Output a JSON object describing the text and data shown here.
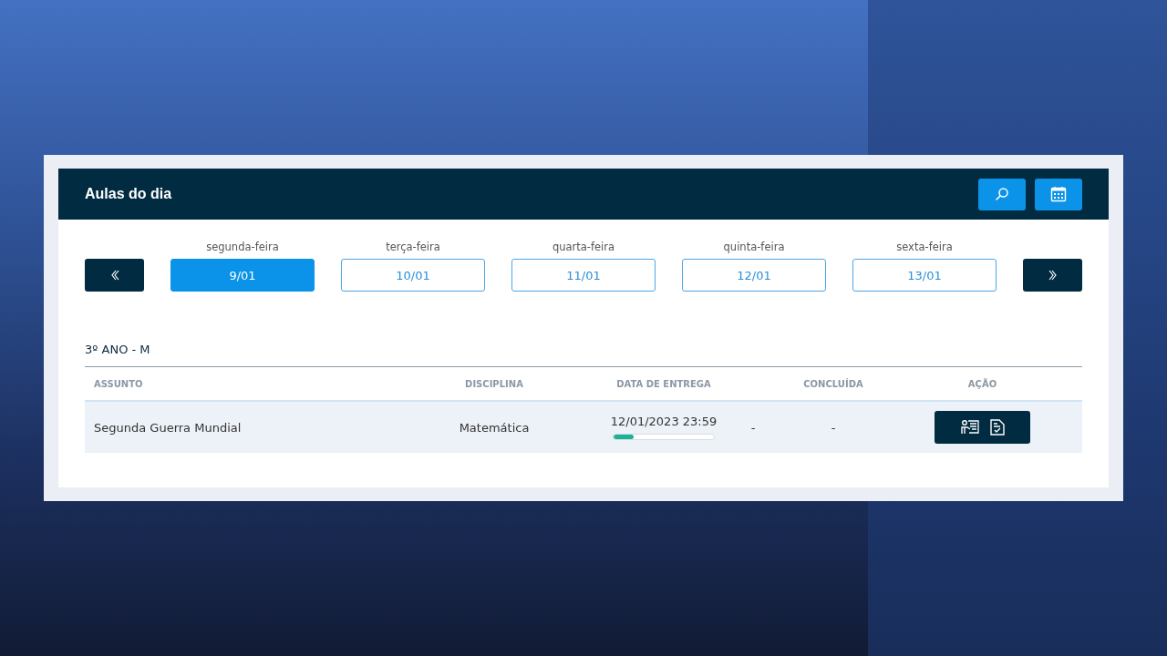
{
  "card": {
    "title": "Aulas do dia"
  },
  "days": [
    {
      "weekday": "segunda-feira",
      "date": "9/01",
      "selected": true
    },
    {
      "weekday": "terça-feira",
      "date": "10/01",
      "selected": false
    },
    {
      "weekday": "quarta-feira",
      "date": "11/01",
      "selected": false
    },
    {
      "weekday": "quinta-feira",
      "date": "12/01",
      "selected": false
    },
    {
      "weekday": "sexta-feira",
      "date": "13/01",
      "selected": false
    }
  ],
  "class_name": "3º ANO - M",
  "table": {
    "columns": [
      {
        "label": "ASSUNTO"
      },
      {
        "label": "DISCIPLINA"
      },
      {
        "label": "DATA DE ENTREGA"
      },
      {},
      {
        "label": "CONCLUÍDA"
      },
      {
        "label": "AÇÃO"
      }
    ],
    "rows": [
      {
        "subject": "Segunda Guerra Mundial",
        "discipline": "Matemática",
        "due_date": "12/01/2023 23:59",
        "level": 0.2,
        "column_4": "-",
        "completed": "-"
      }
    ]
  }
}
